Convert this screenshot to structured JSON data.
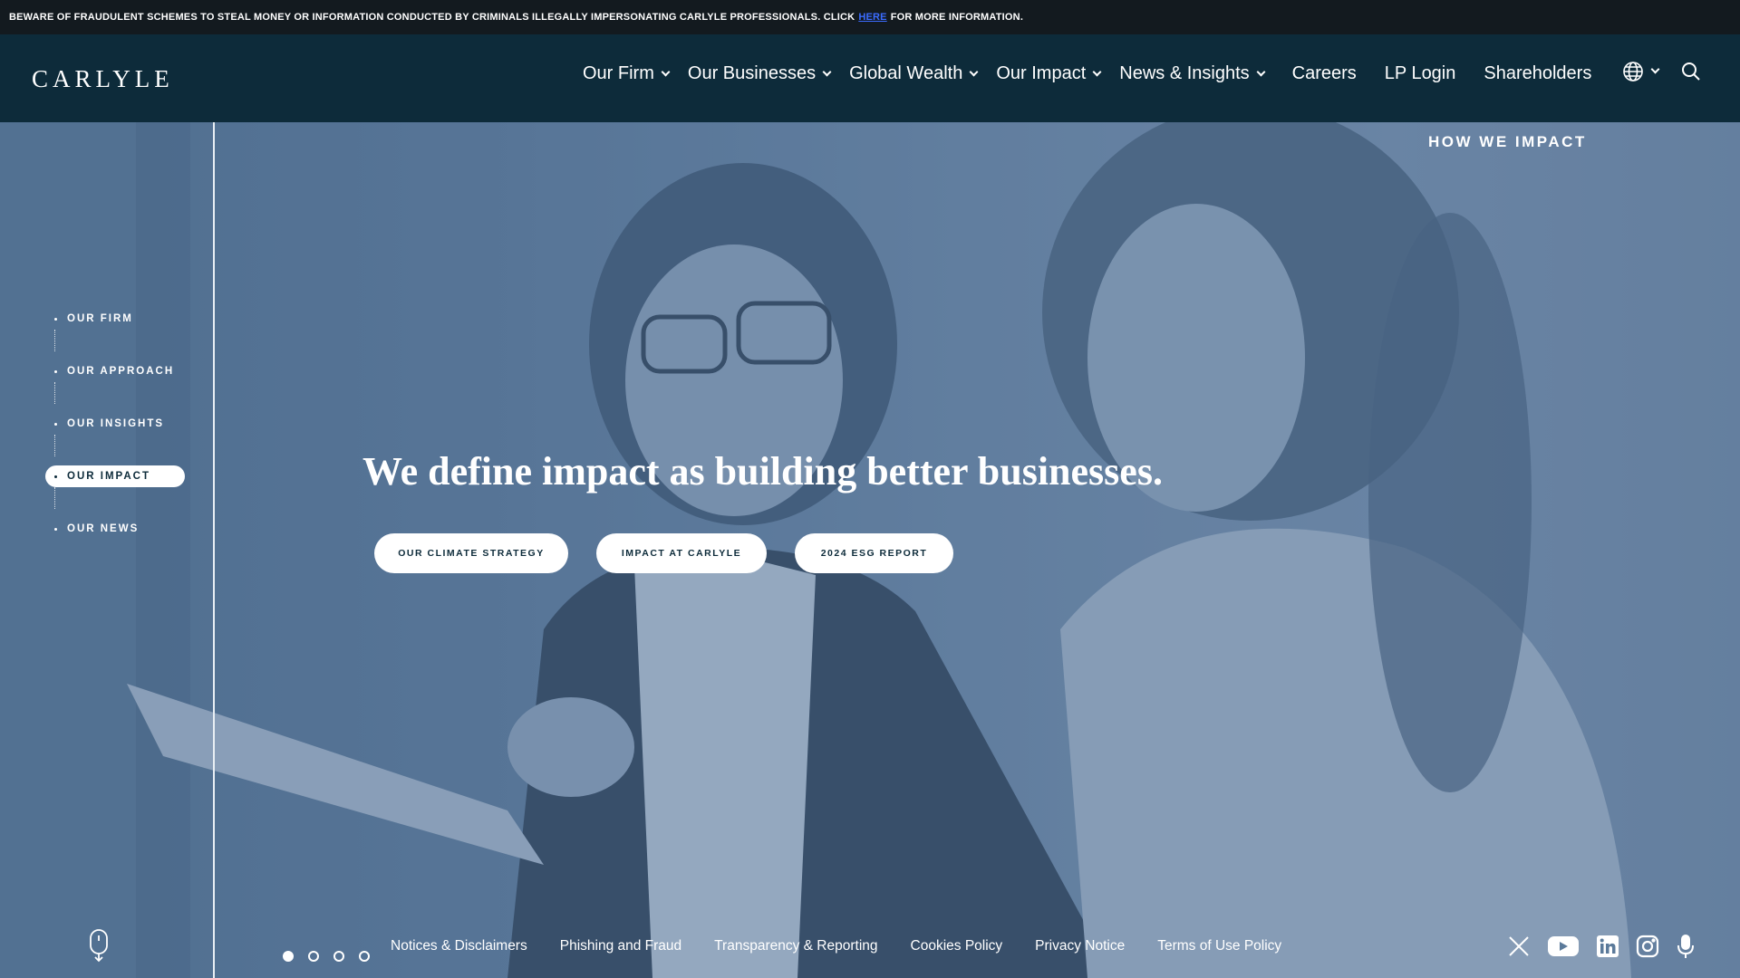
{
  "alert": {
    "text_before": "BEWARE OF FRAUDULENT SCHEMES TO STEAL MONEY OR INFORMATION CONDUCTED BY CRIMINALS ILLEGALLY IMPERSONATING CARLYLE PROFESSIONALS. CLICK",
    "link_label": "HERE",
    "text_after": "FOR MORE INFORMATION."
  },
  "header": {
    "logo": "CARLYLE",
    "nav": [
      {
        "label": "Our Firm"
      },
      {
        "label": "Our Businesses"
      },
      {
        "label": "Global Wealth"
      },
      {
        "label": "Our Impact"
      },
      {
        "label": "News & Insights"
      },
      {
        "label": "Careers"
      },
      {
        "label": "LP Login"
      },
      {
        "label": "Shareholders"
      }
    ]
  },
  "hero": {
    "kicker": "HOW WE IMPACT",
    "title": "We define impact as building better businesses.",
    "buttons": [
      {
        "label": "OUR CLIMATE STRATEGY"
      },
      {
        "label": "IMPACT AT CARLYLE"
      },
      {
        "label": "2024 ESG REPORT"
      }
    ]
  },
  "side_nav": {
    "items": [
      {
        "label": "OUR FIRM"
      },
      {
        "label": "OUR APPROACH"
      },
      {
        "label": "OUR INSIGHTS"
      },
      {
        "label": "OUR IMPACT"
      },
      {
        "label": "OUR NEWS"
      }
    ],
    "active_index": 3
  },
  "carousel": {
    "count": 4,
    "active_index": 0
  },
  "footer": {
    "links": [
      {
        "label": "Notices & Disclaimers"
      },
      {
        "label": "Phishing and Fraud"
      },
      {
        "label": "Transparency & Reporting"
      },
      {
        "label": "Cookies Policy"
      },
      {
        "label": "Privacy Notice"
      },
      {
        "label": "Terms of Use Policy"
      }
    ],
    "social_icons": [
      "x-icon",
      "youtube-icon",
      "linkedin-icon",
      "instagram-icon",
      "microphone-icon"
    ]
  },
  "colors": {
    "alert_bg": "#131a1f",
    "header_bg": "#0d2b3a",
    "hero_tint": "#5b7a9a",
    "link_blue": "#3b6cff",
    "button_text": "#0d2b3a"
  }
}
